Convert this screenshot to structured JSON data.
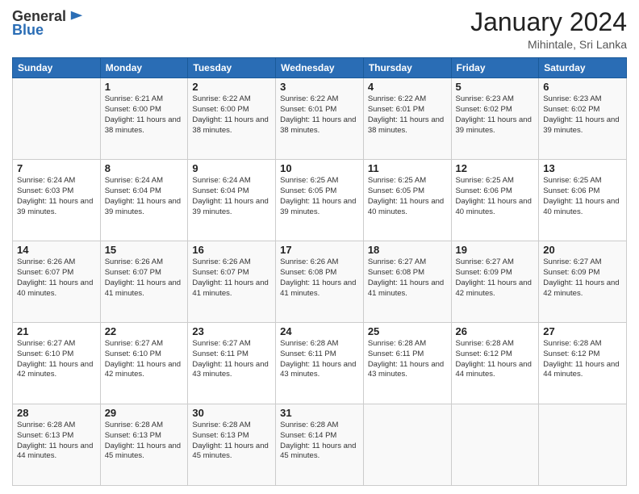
{
  "header": {
    "logo_general": "General",
    "logo_blue": "Blue",
    "month_title": "January 2024",
    "subtitle": "Mihintale, Sri Lanka"
  },
  "days_of_week": [
    "Sunday",
    "Monday",
    "Tuesday",
    "Wednesday",
    "Thursday",
    "Friday",
    "Saturday"
  ],
  "weeks": [
    [
      {
        "day": "",
        "info": ""
      },
      {
        "day": "1",
        "info": "Sunrise: 6:21 AM\nSunset: 6:00 PM\nDaylight: 11 hours\nand 38 minutes."
      },
      {
        "day": "2",
        "info": "Sunrise: 6:22 AM\nSunset: 6:00 PM\nDaylight: 11 hours\nand 38 minutes."
      },
      {
        "day": "3",
        "info": "Sunrise: 6:22 AM\nSunset: 6:01 PM\nDaylight: 11 hours\nand 38 minutes."
      },
      {
        "day": "4",
        "info": "Sunrise: 6:22 AM\nSunset: 6:01 PM\nDaylight: 11 hours\nand 38 minutes."
      },
      {
        "day": "5",
        "info": "Sunrise: 6:23 AM\nSunset: 6:02 PM\nDaylight: 11 hours\nand 39 minutes."
      },
      {
        "day": "6",
        "info": "Sunrise: 6:23 AM\nSunset: 6:02 PM\nDaylight: 11 hours\nand 39 minutes."
      }
    ],
    [
      {
        "day": "7",
        "info": "Sunrise: 6:24 AM\nSunset: 6:03 PM\nDaylight: 11 hours\nand 39 minutes."
      },
      {
        "day": "8",
        "info": "Sunrise: 6:24 AM\nSunset: 6:04 PM\nDaylight: 11 hours\nand 39 minutes."
      },
      {
        "day": "9",
        "info": "Sunrise: 6:24 AM\nSunset: 6:04 PM\nDaylight: 11 hours\nand 39 minutes."
      },
      {
        "day": "10",
        "info": "Sunrise: 6:25 AM\nSunset: 6:05 PM\nDaylight: 11 hours\nand 39 minutes."
      },
      {
        "day": "11",
        "info": "Sunrise: 6:25 AM\nSunset: 6:05 PM\nDaylight: 11 hours\nand 40 minutes."
      },
      {
        "day": "12",
        "info": "Sunrise: 6:25 AM\nSunset: 6:06 PM\nDaylight: 11 hours\nand 40 minutes."
      },
      {
        "day": "13",
        "info": "Sunrise: 6:25 AM\nSunset: 6:06 PM\nDaylight: 11 hours\nand 40 minutes."
      }
    ],
    [
      {
        "day": "14",
        "info": "Sunrise: 6:26 AM\nSunset: 6:07 PM\nDaylight: 11 hours\nand 40 minutes."
      },
      {
        "day": "15",
        "info": "Sunrise: 6:26 AM\nSunset: 6:07 PM\nDaylight: 11 hours\nand 41 minutes."
      },
      {
        "day": "16",
        "info": "Sunrise: 6:26 AM\nSunset: 6:07 PM\nDaylight: 11 hours\nand 41 minutes."
      },
      {
        "day": "17",
        "info": "Sunrise: 6:26 AM\nSunset: 6:08 PM\nDaylight: 11 hours\nand 41 minutes."
      },
      {
        "day": "18",
        "info": "Sunrise: 6:27 AM\nSunset: 6:08 PM\nDaylight: 11 hours\nand 41 minutes."
      },
      {
        "day": "19",
        "info": "Sunrise: 6:27 AM\nSunset: 6:09 PM\nDaylight: 11 hours\nand 42 minutes."
      },
      {
        "day": "20",
        "info": "Sunrise: 6:27 AM\nSunset: 6:09 PM\nDaylight: 11 hours\nand 42 minutes."
      }
    ],
    [
      {
        "day": "21",
        "info": "Sunrise: 6:27 AM\nSunset: 6:10 PM\nDaylight: 11 hours\nand 42 minutes."
      },
      {
        "day": "22",
        "info": "Sunrise: 6:27 AM\nSunset: 6:10 PM\nDaylight: 11 hours\nand 42 minutes."
      },
      {
        "day": "23",
        "info": "Sunrise: 6:27 AM\nSunset: 6:11 PM\nDaylight: 11 hours\nand 43 minutes."
      },
      {
        "day": "24",
        "info": "Sunrise: 6:28 AM\nSunset: 6:11 PM\nDaylight: 11 hours\nand 43 minutes."
      },
      {
        "day": "25",
        "info": "Sunrise: 6:28 AM\nSunset: 6:11 PM\nDaylight: 11 hours\nand 43 minutes."
      },
      {
        "day": "26",
        "info": "Sunrise: 6:28 AM\nSunset: 6:12 PM\nDaylight: 11 hours\nand 44 minutes."
      },
      {
        "day": "27",
        "info": "Sunrise: 6:28 AM\nSunset: 6:12 PM\nDaylight: 11 hours\nand 44 minutes."
      }
    ],
    [
      {
        "day": "28",
        "info": "Sunrise: 6:28 AM\nSunset: 6:13 PM\nDaylight: 11 hours\nand 44 minutes."
      },
      {
        "day": "29",
        "info": "Sunrise: 6:28 AM\nSunset: 6:13 PM\nDaylight: 11 hours\nand 45 minutes."
      },
      {
        "day": "30",
        "info": "Sunrise: 6:28 AM\nSunset: 6:13 PM\nDaylight: 11 hours\nand 45 minutes."
      },
      {
        "day": "31",
        "info": "Sunrise: 6:28 AM\nSunset: 6:14 PM\nDaylight: 11 hours\nand 45 minutes."
      },
      {
        "day": "",
        "info": ""
      },
      {
        "day": "",
        "info": ""
      },
      {
        "day": "",
        "info": ""
      }
    ]
  ]
}
